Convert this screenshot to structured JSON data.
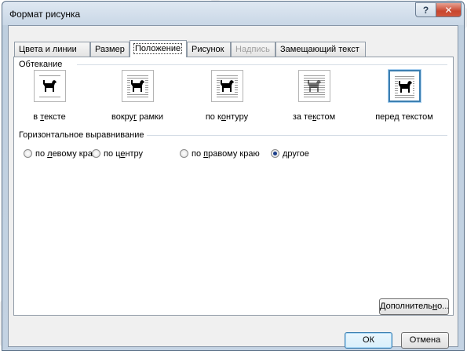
{
  "window": {
    "title": "Формат рисунка",
    "help_label": "?",
    "close_label": "✕"
  },
  "tabs": [
    {
      "label": "Цвета и линии",
      "state": "normal"
    },
    {
      "label": "Размер",
      "state": "normal"
    },
    {
      "label": "Положение",
      "state": "active"
    },
    {
      "label": "Рисунок",
      "state": "normal"
    },
    {
      "label": "Надпись",
      "state": "disabled"
    },
    {
      "label": "Замещающий текст",
      "state": "normal"
    }
  ],
  "wrapping": {
    "group_label": "Обтекание",
    "options": [
      {
        "id": "in-text",
        "pre": "в ",
        "ul": "т",
        "post": "ексте",
        "selected": false
      },
      {
        "id": "around-frame",
        "pre": "вокру",
        "ul": "г",
        "post": " рамки",
        "selected": false
      },
      {
        "id": "contour",
        "pre": "по к",
        "ul": "о",
        "post": "нтуру",
        "selected": false
      },
      {
        "id": "behind-text",
        "pre": "за те",
        "ul": "к",
        "post": "стом",
        "selected": false
      },
      {
        "id": "in-front-text",
        "pre": "пере",
        "ul": "д",
        "post": " текстом",
        "selected": true
      }
    ]
  },
  "alignment": {
    "group_label": "Горизонтальное выравнивание",
    "options": [
      {
        "id": "left",
        "pre": "по ",
        "ul": "л",
        "post": "евому краю",
        "checked": false
      },
      {
        "id": "center",
        "pre": "по ц",
        "ul": "е",
        "post": "нтру",
        "checked": false
      },
      {
        "id": "right",
        "pre": "по ",
        "ul": "п",
        "post": "равому краю",
        "checked": false
      },
      {
        "id": "other",
        "pre": "",
        "ul": "д",
        "post": "ругое",
        "checked": true
      }
    ]
  },
  "buttons": {
    "advanced": {
      "pre": "Дополнитель",
      "ul": "н",
      "post": "о..."
    },
    "ok": "ОК",
    "cancel": "Отмена"
  }
}
